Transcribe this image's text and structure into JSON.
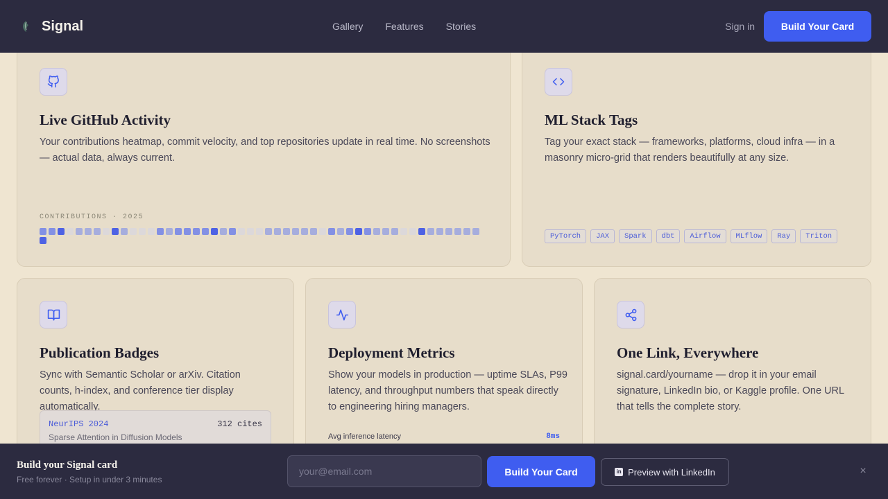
{
  "nav": {
    "brand": "Signal",
    "links": [
      "Gallery",
      "Features",
      "Stories"
    ],
    "signin": "Sign in",
    "cta": "Build Your Card"
  },
  "cards": {
    "github": {
      "icon": "github-icon",
      "title": "Live GitHub Activity",
      "desc": "Your contributions heatmap, commit velocity, and top repositories update in real time. No screenshots — actual data, always current.",
      "heat_label": "CONTRIBUTIONS · 2025",
      "heat_levels": [
        2,
        2,
        3,
        0,
        1,
        1,
        1,
        0,
        3,
        1,
        0,
        0,
        0,
        2,
        1,
        2,
        2,
        2,
        2,
        3,
        1,
        2,
        0,
        0,
        0,
        1,
        1,
        1,
        1,
        1,
        1,
        0,
        2,
        1,
        2,
        3,
        2,
        1,
        1,
        1,
        0,
        0,
        3,
        1,
        1,
        1,
        1,
        1,
        1,
        3
      ]
    },
    "ml": {
      "icon": "code-icon",
      "title": "ML Stack Tags",
      "desc": "Tag your exact stack — frameworks, platforms, cloud infra — in a masonry micro-grid that renders beautifully at any size.",
      "tags": [
        "PyTorch",
        "JAX",
        "Spark",
        "dbt",
        "Airflow",
        "MLflow",
        "Ray",
        "Triton"
      ]
    },
    "publication": {
      "icon": "book-icon",
      "title": "Publication Badges",
      "desc": "Sync with Semantic Scholar or arXiv. Citation counts, h-index, and conference tier display automatically.",
      "venue": "NeurIPS 2024",
      "cites": "312 cites",
      "paper_title": "Sparse Attention in Diffusion Models"
    },
    "deployment": {
      "icon": "activity-icon",
      "title": "Deployment Metrics",
      "desc": "Show your models in production — uptime SLAs, P99 latency, and throughput numbers that speak directly to engineering hiring managers.",
      "metric_label": "Avg inference latency",
      "metric_value": "8ms"
    },
    "link": {
      "icon": "share-icon",
      "title": "One Link, Everywhere",
      "desc": "signal.card/yourname — drop it in your email signature, LinkedIn bio, or Kaggle profile. One URL that tells the complete story."
    }
  },
  "cta_bar": {
    "title": "Build your Signal card",
    "subtitle": "Free forever · Setup in under 3 minutes",
    "email_placeholder": "your@email.com",
    "build": "Build Your Card",
    "preview": "Preview with LinkedIn",
    "close": "×"
  },
  "colors": {
    "accent": "#3f5df0",
    "nav_bg": "#2c2b40",
    "page_bg": "#efe5d1",
    "heat_levels": [
      "#dcd8da",
      "#a6addd",
      "#8390e4",
      "#4e62e4"
    ]
  }
}
